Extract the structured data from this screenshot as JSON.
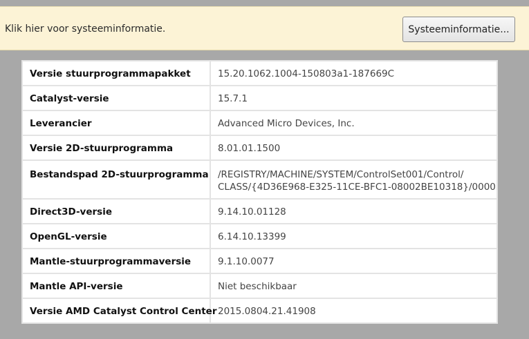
{
  "info_bar": {
    "text": "Klik hier voor systeeminformatie.",
    "button_label": "Systeeminformatie..."
  },
  "details": {
    "rows": [
      {
        "label": "Versie stuurprogrammapakket",
        "value": "15.20.1062.1004-150803a1-187669C"
      },
      {
        "label": "Catalyst-versie",
        "value": "15.7.1"
      },
      {
        "label": "Leverancier",
        "value": "Advanced Micro Devices, Inc."
      },
      {
        "label": "Versie 2D-stuurprogramma",
        "value": "8.01.01.1500"
      },
      {
        "label": "Bestandspad 2D-stuurprogramma",
        "value_line1": "/REGISTRY/MACHINE/SYSTEM/ControlSet001/Control/",
        "value_line2": "CLASS/{4D36E968-E325-11CE-BFC1-08002BE10318}/0000"
      },
      {
        "label": "Direct3D-versie",
        "value": "9.14.10.01128"
      },
      {
        "label": "OpenGL-versie",
        "value": "6.14.10.13399"
      },
      {
        "label": "Mantle-stuurprogrammaversie",
        "value": "9.1.10.0077"
      },
      {
        "label": "Mantle API-versie",
        "value": "Niet beschikbaar"
      },
      {
        "label": "Versie AMD Catalyst Control Center",
        "value": "2015.0804.21.41908"
      }
    ]
  }
}
